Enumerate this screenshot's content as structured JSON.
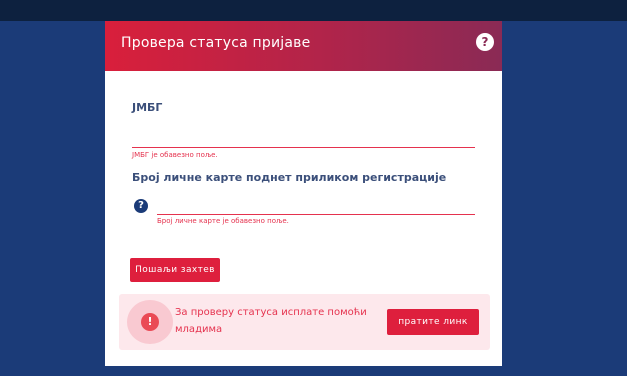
{
  "header": {
    "title": "Провера статуса пријаве",
    "help_icon": "help-icon",
    "help_glyph": "?"
  },
  "form": {
    "jmbg": {
      "label": "ЈМБГ",
      "value": "",
      "error": "ЈМБГ је обавезно поље."
    },
    "id_card": {
      "label": "Број личне карте поднет приликом регистрације",
      "value": "",
      "error": "Број личне карте је обавезно поље.",
      "hint_icon": "question-icon",
      "hint_glyph": "?"
    },
    "submit_label": "Пошаљи захтев"
  },
  "notice": {
    "icon": "info-icon",
    "icon_glyph": "!",
    "text": "За проверу статуса исплате помоћи младима",
    "link_label": "пратите линк"
  },
  "colors": {
    "background": "#1b3b78",
    "topbar": "#0d213f",
    "accent": "#de1f3d",
    "header_gradient_end": "#8a2a55",
    "error": "#e5324e",
    "notice_bg": "#fde8ec"
  }
}
